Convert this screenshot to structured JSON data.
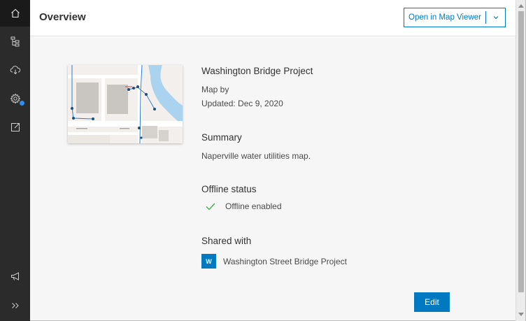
{
  "header": {
    "title": "Overview",
    "open_button_label": "Open in Map Viewer"
  },
  "rail": {
    "items": [
      {
        "icon": "home-icon"
      },
      {
        "icon": "layers-tree-icon"
      },
      {
        "icon": "cloud-download-icon"
      },
      {
        "icon": "gear-icon"
      },
      {
        "icon": "export-icon"
      },
      {
        "icon": "megaphone-icon"
      },
      {
        "icon": "expand-chevrons-icon"
      }
    ],
    "expand_label": ">>"
  },
  "map": {
    "title": "Washington Bridge Project",
    "by": "Map by",
    "updated": "Updated: Dec 9, 2020"
  },
  "summary": {
    "heading": "Summary",
    "text": "Naperville water utilities map."
  },
  "offline": {
    "heading": "Offline status",
    "status": "Offline enabled"
  },
  "shared": {
    "heading": "Shared with",
    "group_initial": "W",
    "group_name": "Washington Street Bridge Project"
  },
  "actions": {
    "edit_label": "Edit"
  },
  "colors": {
    "accent": "#0079c1",
    "rail": "#2b2b2b",
    "check": "#35ac46",
    "notification_dot": "#2f8ff0"
  }
}
